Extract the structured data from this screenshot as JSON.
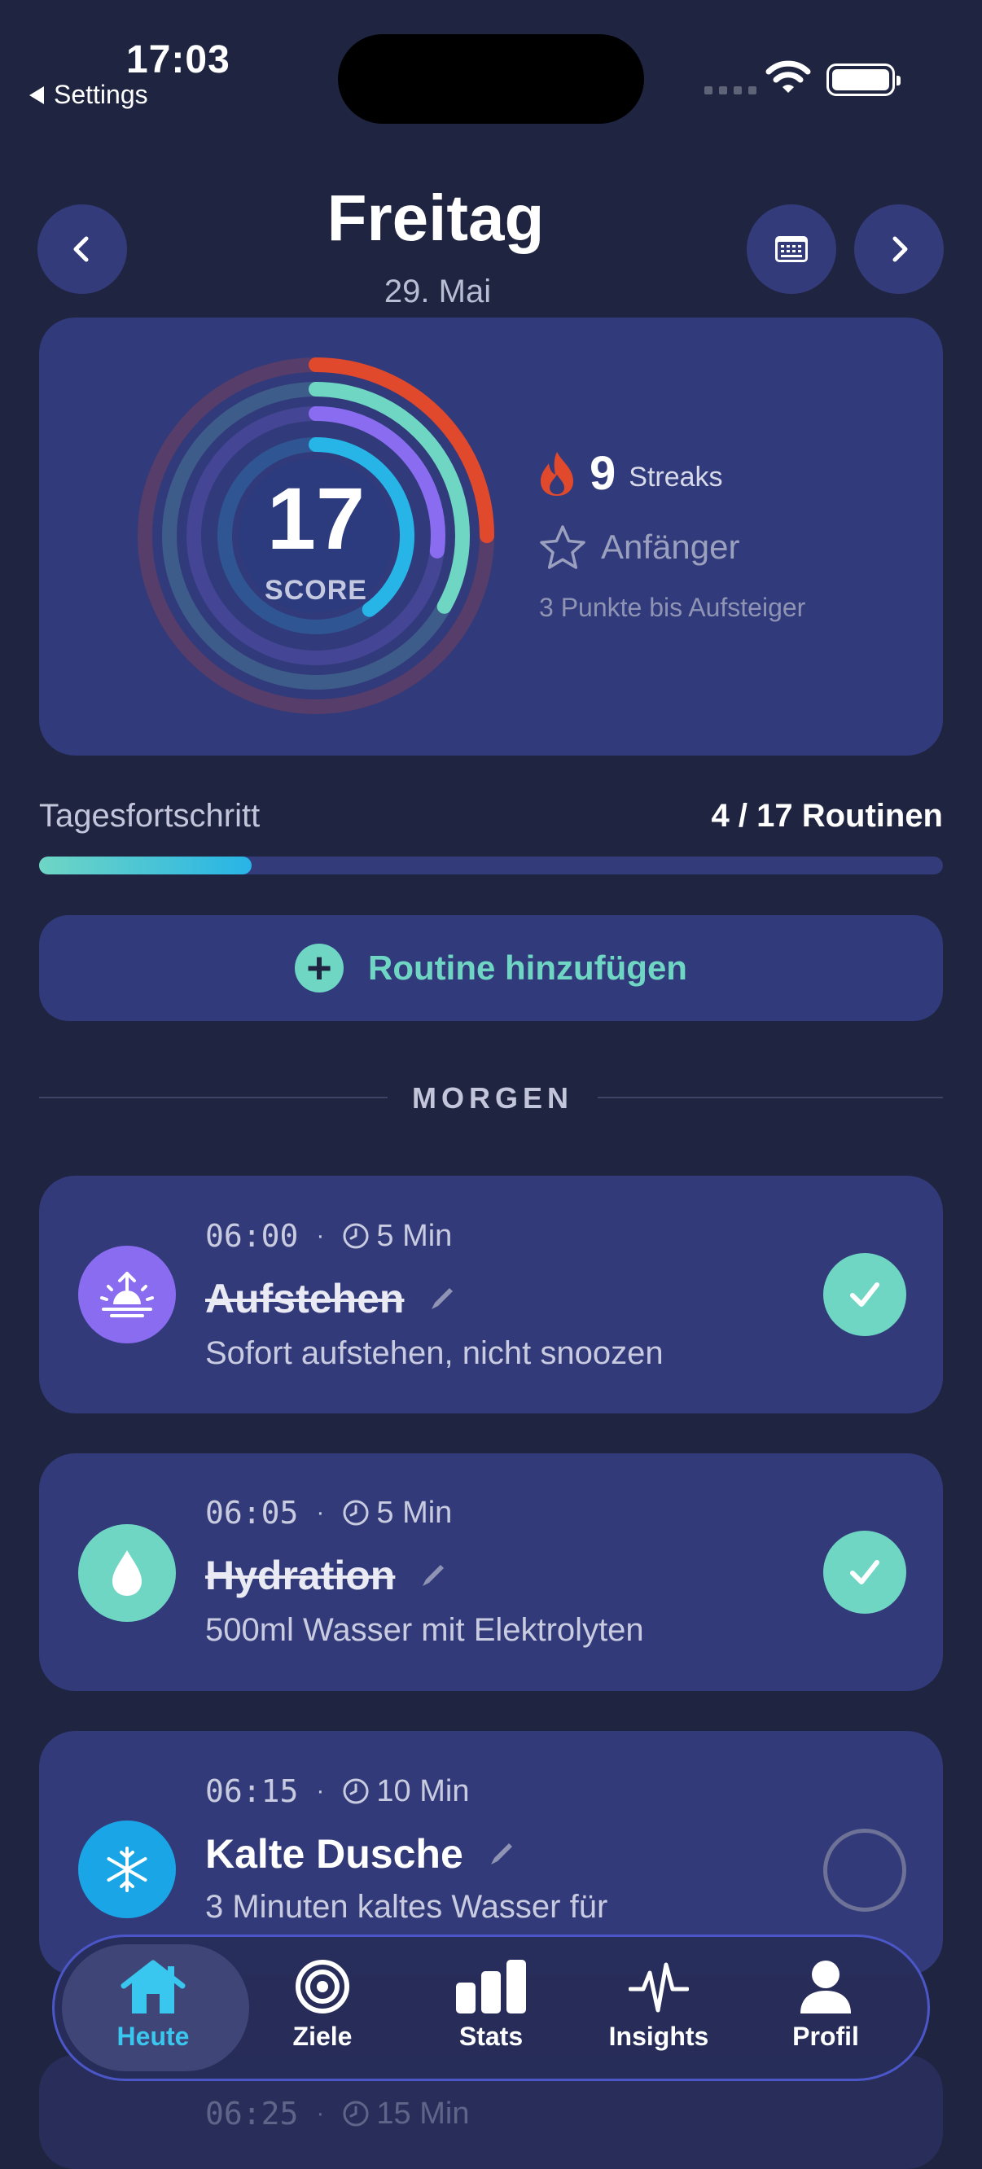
{
  "status_bar": {
    "time": "17:03",
    "back_label": "Settings"
  },
  "header": {
    "day": "Freitag",
    "date": "29. Mai"
  },
  "score_card": {
    "score": "17",
    "score_label": "SCORE",
    "streak_count": "9",
    "streak_label": "Streaks",
    "level": "Anfänger",
    "level_hint": "3 Punkte bis Aufsteiger",
    "rings": [
      {
        "color": "#e0492c",
        "progress": 0.25
      },
      {
        "color": "#6fd6c4",
        "progress": 0.33
      },
      {
        "color": "#8a6cf0",
        "progress": 0.27
      },
      {
        "color": "#27b4e6",
        "progress": 0.4
      }
    ]
  },
  "progress": {
    "label": "Tagesfortschritt",
    "value_text": "4 / 17 Routinen",
    "fraction": 0.235
  },
  "add_routine": {
    "label": "Routine hinzufügen"
  },
  "section": {
    "title": "MORGEN"
  },
  "routines": [
    {
      "time": "06:00",
      "duration": "5 Min",
      "name": "Aufstehen",
      "desc": "Sofort aufstehen, nicht snoozen",
      "done": true,
      "icon": "sunrise-icon",
      "icon_color": "#8a6cf0"
    },
    {
      "time": "06:05",
      "duration": "5 Min",
      "name": "Hydration",
      "desc": "500ml Wasser mit Elektrolyten",
      "done": true,
      "icon": "water-drop-icon",
      "icon_color": "#6fd6c4"
    },
    {
      "time": "06:15",
      "duration": "10 Min",
      "name": "Kalte Dusche",
      "desc": "3 Minuten kaltes Wasser für",
      "done": false,
      "icon": "snowflake-icon",
      "icon_color": "#1aa6e6"
    },
    {
      "time": "06:25",
      "duration": "15 Min"
    }
  ],
  "tabs": [
    {
      "label": "Heute",
      "icon": "home-icon",
      "active": true
    },
    {
      "label": "Ziele",
      "icon": "target-icon"
    },
    {
      "label": "Stats",
      "icon": "bar-chart-icon"
    },
    {
      "label": "Insights",
      "icon": "pulse-icon"
    },
    {
      "label": "Profil",
      "icon": "person-icon"
    }
  ],
  "colors": {
    "background": "#1f2440",
    "card": "#323a79",
    "accent_teal": "#6fd6c4",
    "accent_blue": "#39c7f0"
  }
}
